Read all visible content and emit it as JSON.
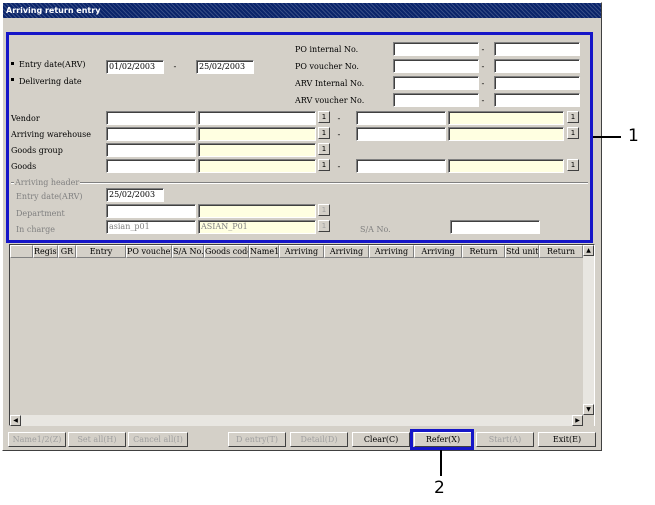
{
  "window": {
    "title": "Arriving return entry"
  },
  "search": {
    "entry_date_label": "Entry date(ARV)",
    "delivering_date_label": "Delivering date",
    "date_from": "01/02/2003",
    "date_to": "25/02/2003",
    "dash": "-",
    "po_internal_label": "PO internal No.",
    "po_voucher_label": "PO voucher No.",
    "arv_internal_label": "ARV Internal No.",
    "arv_voucher_label": "ARV voucher No.",
    "vendor_label": "Vendor",
    "arriving_warehouse_label": "Arriving warehouse",
    "goods_group_label": "Goods group",
    "goods_label": "Goods",
    "lookup_button_label": "1"
  },
  "header": {
    "group_title": "Arriving header",
    "entry_date_label": "Entry date(ARV)",
    "entry_date_value": "25/02/2003",
    "department_label": "Department",
    "in_charge_label": "In charge",
    "in_charge_code": "asian_p01",
    "in_charge_name": "ASIAN_P01",
    "sa_no_label": "S/A No."
  },
  "grid": {
    "columns": [
      "Regist",
      "GR",
      "Entry",
      "PO voucher",
      "S/A No.",
      "Goods code",
      "Name1",
      "Arriving",
      "Arriving",
      "Arriving",
      "Arriving",
      "Return",
      "Std unit",
      "Return"
    ],
    "up_arrow": "▲",
    "down_arrow": "▼",
    "left_arrow": "◀",
    "right_arrow": "▶"
  },
  "buttons": {
    "name12": "Name1/2(Z)",
    "set_all": "Set all(H)",
    "cancel_all": "Cancel all(I)",
    "d_entry": "D entry(T)",
    "detail": "Detail(D)",
    "clear": "Clear(C)",
    "refer": "Refer(X)",
    "start": "Start(A)",
    "exit": "Exit(E)"
  },
  "callouts": {
    "one": "1",
    "two": "2"
  },
  "colors": {
    "callout": "#1515c8",
    "titlebar": "#0a246a",
    "highlight_field": "#ffffe1",
    "face": "#d4d0c8"
  }
}
